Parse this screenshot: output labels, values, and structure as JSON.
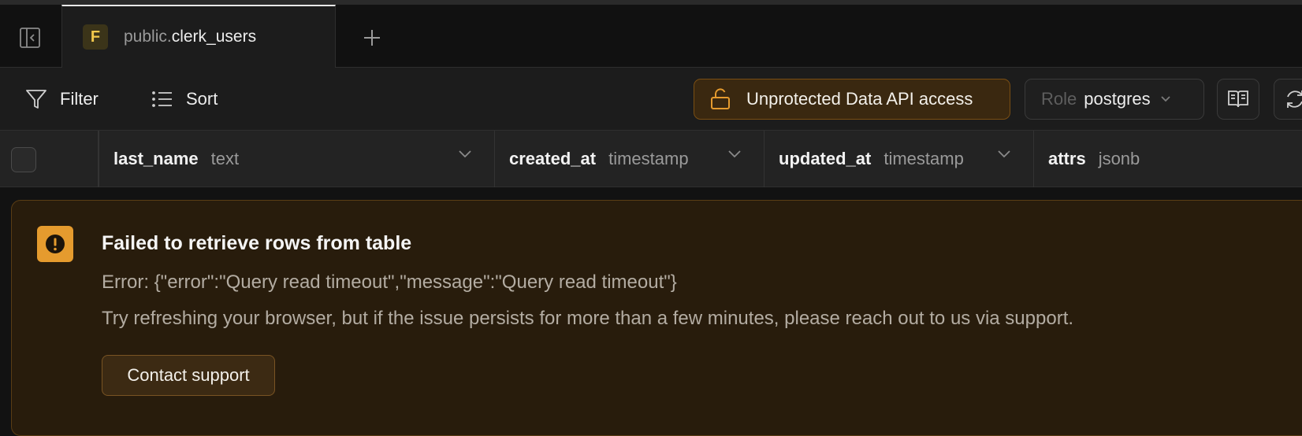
{
  "tabs": [
    {
      "badge": "F",
      "schema": "public.",
      "name": "clerk_users"
    }
  ],
  "toolbar": {
    "filter_label": "Filter",
    "sort_label": "Sort",
    "api_access_label": "Unprotected Data API access",
    "role_label": "Role",
    "role_value": "postgres"
  },
  "columns": [
    {
      "name": "last_name",
      "type": "text"
    },
    {
      "name": "created_at",
      "type": "timestamp"
    },
    {
      "name": "updated_at",
      "type": "timestamp"
    },
    {
      "name": "attrs",
      "type": "jsonb"
    }
  ],
  "error": {
    "title": "Failed to retrieve rows from table",
    "message": "Error: {\"error\":\"Query read timeout\",\"message\":\"Query read timeout\"}",
    "hint": "Try refreshing your browser, but if the issue persists for more than a few minutes, please reach out to us via support.",
    "contact_label": "Contact support"
  },
  "colors": {
    "background": "#121212",
    "toolbar": "#1c1c1c",
    "warning_accent": "#e59b2e",
    "warning_panel": "#281c0c",
    "tab_badge": "#f2c94c"
  },
  "icons": [
    "sidebar-toggle-icon",
    "plus-icon",
    "filter-icon",
    "list-icon",
    "unlock-icon",
    "chevron-down-icon",
    "book-icon",
    "refresh-icon",
    "alert-icon"
  ]
}
